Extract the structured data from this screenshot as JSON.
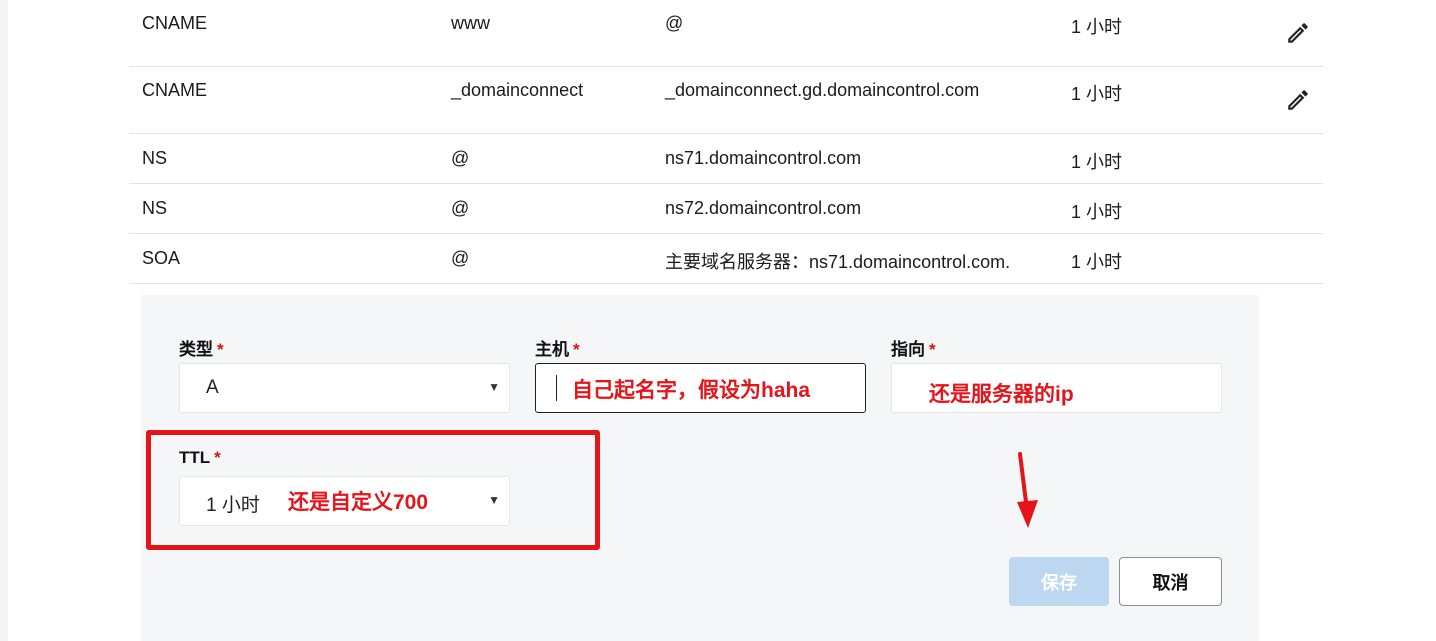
{
  "records": [
    {
      "type": "CNAME",
      "host": "www",
      "value": "@",
      "ttl": "1 小时",
      "editable": true
    },
    {
      "type": "CNAME",
      "host": "_domainconnect",
      "value": "_domainconnect.gd.domaincontrol.com",
      "ttl": "1 小时",
      "editable": true
    },
    {
      "type": "NS",
      "host": "@",
      "value": "ns71.domaincontrol.com",
      "ttl": "1 小时",
      "editable": false
    },
    {
      "type": "NS",
      "host": "@",
      "value": "ns72.domaincontrol.com",
      "ttl": "1 小时",
      "editable": false
    },
    {
      "type": "SOA",
      "host": "@",
      "value": "主要域名服务器：ns71.domaincontrol.com.",
      "ttl": "1 小时",
      "editable": false
    }
  ],
  "form": {
    "type_label": "类型",
    "type_value": "A",
    "host_label": "主机",
    "host_value": "",
    "points_to_label": "指向",
    "points_to_value": "",
    "ttl_label": "TTL",
    "ttl_value": "1 小时",
    "required_mark": "*",
    "save_label": "保存",
    "cancel_label": "取消"
  },
  "annotations": {
    "host_note": "自己起名字，假设为haha",
    "points_to_note": "还是服务器的ip",
    "ttl_note": "还是自定义700"
  },
  "colors": {
    "annotation_red": "#e4141b",
    "save_button_disabled": "#bcd7ef",
    "panel_bg": "#f5f6f7"
  },
  "icons": {
    "edit": "pencil-icon",
    "dropdown": "caret-down-icon"
  }
}
